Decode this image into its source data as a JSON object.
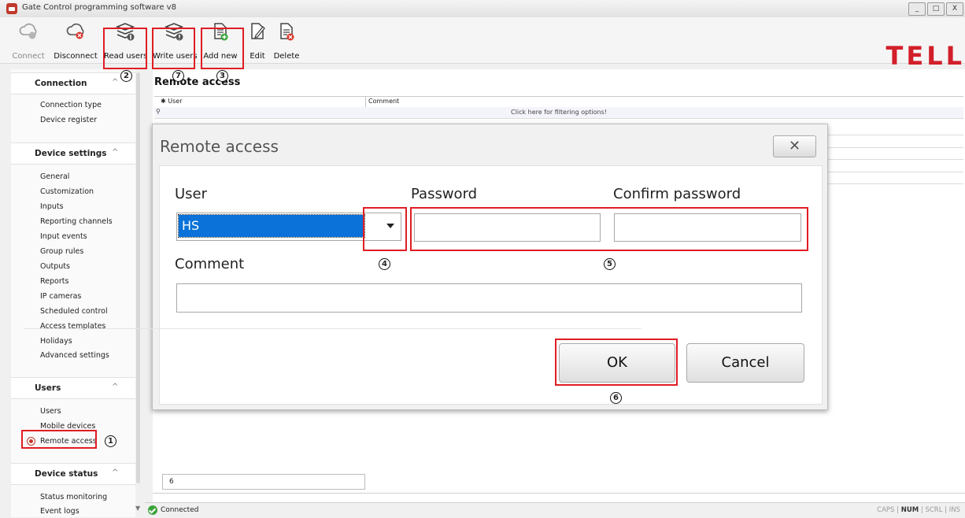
{
  "window": {
    "title": "Gate Control programming software v8",
    "controls": [
      "_",
      "□",
      "X"
    ]
  },
  "toolbar": {
    "connect": "Connect",
    "disconnect": "Disconnect",
    "read_users": "Read users",
    "write_users": "Write users",
    "add_new": "Add new",
    "edit": "Edit",
    "delete": "Delete"
  },
  "logo": "TELL",
  "sidebar": {
    "groups": {
      "connection": {
        "title": "Connection",
        "items": [
          "Connection type",
          "Device register"
        ]
      },
      "device_settings": {
        "title": "Device settings",
        "items": [
          "General",
          "Customization",
          "Inputs",
          "Reporting channels",
          "Input events",
          "Group rules",
          "Outputs",
          "Reports",
          "IP cameras",
          "Scheduled control",
          "Access templates",
          "Holidays",
          "Advanced settings"
        ]
      },
      "users": {
        "title": "Users",
        "items": [
          "Users",
          "Mobile devices",
          "Remote access"
        ]
      },
      "device_status": {
        "title": "Device status",
        "items": [
          "Status monitoring",
          "Event logs"
        ]
      }
    },
    "collapse_glyph": "^"
  },
  "main": {
    "title": "Remote access",
    "columns": [
      "User",
      "Comment"
    ],
    "filter_hint": "Click here for filtering options!",
    "count": "6"
  },
  "dialog": {
    "title": "Remote access",
    "close_glyph": "✕",
    "user_label": "User",
    "user_value": "HS",
    "password_label": "Password",
    "confirm_label": "Confirm password",
    "comment_label": "Comment",
    "ok_label": "OK",
    "cancel_label": "Cancel"
  },
  "status_bar": {
    "connection": "Connected",
    "indicators": [
      "CAPS",
      "NUM",
      "SCRL",
      "INS"
    ]
  },
  "callouts": [
    "1",
    "2",
    "3",
    "4",
    "5",
    "6",
    "7"
  ],
  "colors": {
    "brand_red": "#d21f2a",
    "annotation_red": "#e01d24",
    "selection_blue": "#0a72d8"
  }
}
